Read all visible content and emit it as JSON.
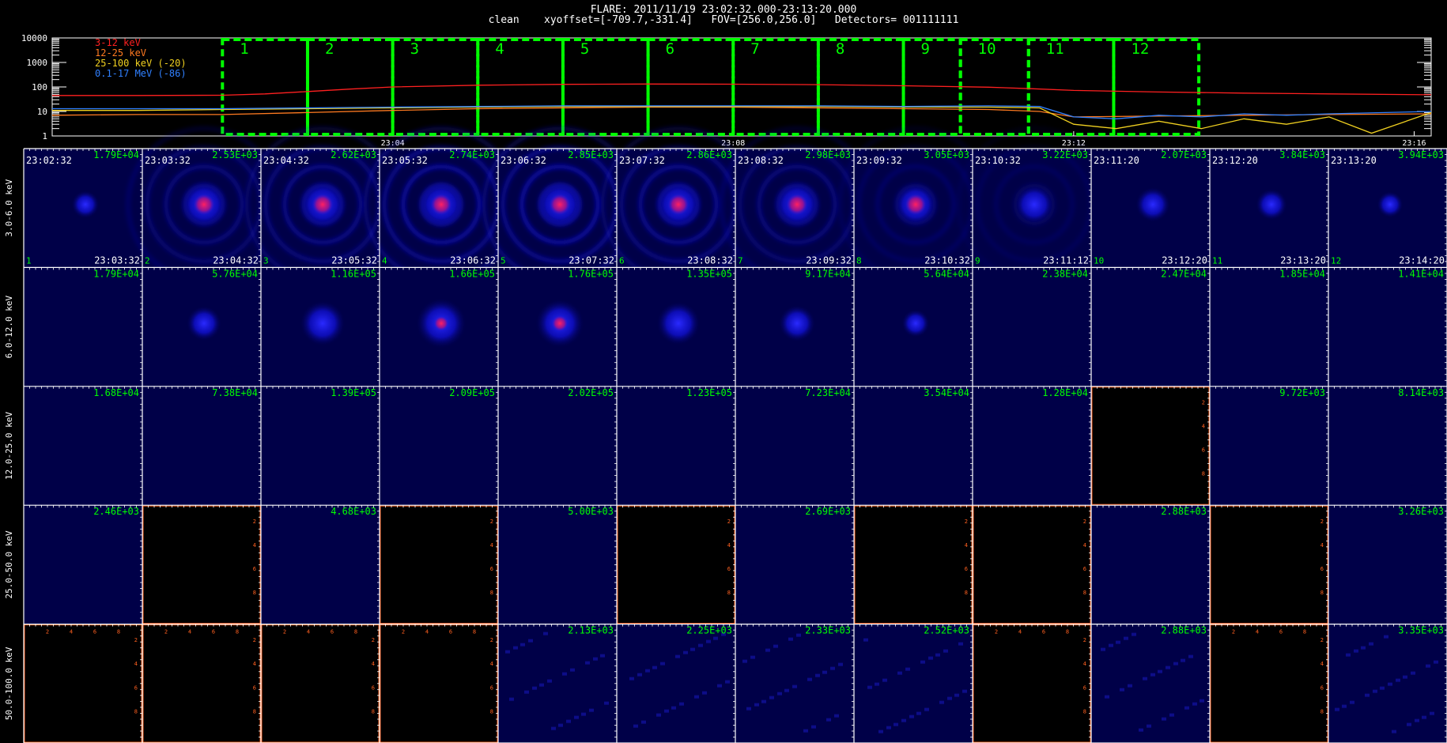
{
  "header": {
    "title": "FLARE: 2011/11/19 23:02:32.000-23:13:20.000",
    "subtitle": "clean    xyoffset=[-709.7,-331.4]   FOV=[256.0,256.0]   Detectors= 001111111"
  },
  "colors": {
    "band_3_12": "#ff2020",
    "band_12_25": "#ff7a20",
    "band_25_100": "#f0d020",
    "band_0_1_17": "#3080ff",
    "interval_box": "#00ff00",
    "grid": "#ffffff",
    "empty_axes": "#ff6020",
    "corner_text": "#00ff00"
  },
  "chart_data": [
    {
      "type": "line",
      "y_scale": "log",
      "ylim": [
        1,
        10000
      ],
      "yticks": [
        "10000",
        "1000",
        "100",
        "10",
        "1"
      ],
      "xticks": [
        "23:04",
        "23:08",
        "23:12",
        "23:16"
      ],
      "xticks_min": [
        2,
        6,
        10,
        14
      ],
      "xlim_min": [
        -2.0,
        14.2
      ],
      "grid": false,
      "legend_placement": "top-left",
      "series": [
        {
          "name": "3-12 keV",
          "color": "#ff2020",
          "points": [
            [
              -2,
              45
            ],
            [
              -1,
              45
            ],
            [
              0,
              46
            ],
            [
              0.5,
              52
            ],
            [
              1,
              65
            ],
            [
              1.5,
              82
            ],
            [
              2,
              100
            ],
            [
              3,
              118
            ],
            [
              4,
              128
            ],
            [
              5,
              132
            ],
            [
              6,
              130
            ],
            [
              7,
              124
            ],
            [
              8,
              112
            ],
            [
              9,
              98
            ],
            [
              9.5,
              85
            ],
            [
              10,
              72
            ],
            [
              11,
              62
            ],
            [
              12,
              56
            ],
            [
              13,
              52
            ],
            [
              14.2,
              48
            ]
          ]
        },
        {
          "name": "12-25 keV",
          "color": "#ff7a20",
          "points": [
            [
              -2,
              7
            ],
            [
              -1,
              7.5
            ],
            [
              0,
              7.5
            ],
            [
              1,
              9
            ],
            [
              2,
              11
            ],
            [
              3,
              13
            ],
            [
              4,
              14
            ],
            [
              5,
              15
            ],
            [
              6,
              15
            ],
            [
              7,
              14
            ],
            [
              8,
              13
            ],
            [
              9,
              12
            ],
            [
              9.6,
              10
            ],
            [
              10,
              6
            ],
            [
              11,
              6.5
            ],
            [
              12,
              7
            ],
            [
              13,
              7.5
            ],
            [
              14.2,
              8
            ]
          ]
        },
        {
          "name": "25-100 keV (-20)",
          "color": "#f0d020",
          "points": [
            [
              -2,
              11
            ],
            [
              -1,
              11
            ],
            [
              0,
              12
            ],
            [
              1,
              13
            ],
            [
              2,
              14
            ],
            [
              3,
              15
            ],
            [
              4,
              16
            ],
            [
              5,
              16
            ],
            [
              6,
              16
            ],
            [
              7,
              16
            ],
            [
              8,
              15
            ],
            [
              9,
              15
            ],
            [
              9.6,
              14
            ],
            [
              10,
              3
            ],
            [
              10.5,
              2
            ],
            [
              11,
              4
            ],
            [
              11.5,
              2
            ],
            [
              12,
              5
            ],
            [
              12.5,
              3
            ],
            [
              13,
              6
            ],
            [
              13.5,
              1.3
            ],
            [
              14.2,
              9
            ]
          ]
        },
        {
          "name": "0.1-17 MeV (-86)",
          "color": "#3080ff",
          "points": [
            [
              -2,
              13
            ],
            [
              -1,
              13
            ],
            [
              0,
              13
            ],
            [
              1,
              14
            ],
            [
              2,
              15
            ],
            [
              3,
              16
            ],
            [
              4,
              17
            ],
            [
              5,
              17
            ],
            [
              6,
              17
            ],
            [
              7,
              17
            ],
            [
              8,
              16
            ],
            [
              9,
              17
            ],
            [
              9.6,
              16
            ],
            [
              10,
              6
            ],
            [
              10.5,
              5
            ],
            [
              11,
              7
            ],
            [
              11.5,
              6
            ],
            [
              12,
              8
            ],
            [
              12.5,
              7
            ],
            [
              13,
              8
            ],
            [
              14.2,
              10
            ]
          ]
        }
      ],
      "intervals": [
        {
          "label": "1",
          "start": 0,
          "end": 1
        },
        {
          "label": "2",
          "start": 1,
          "end": 2
        },
        {
          "label": "3",
          "start": 2,
          "end": 3
        },
        {
          "label": "4",
          "start": 3,
          "end": 4
        },
        {
          "label": "5",
          "start": 4,
          "end": 5
        },
        {
          "label": "6",
          "start": 5,
          "end": 6
        },
        {
          "label": "7",
          "start": 6,
          "end": 7
        },
        {
          "label": "8",
          "start": 7,
          "end": 8
        },
        {
          "label": "9",
          "start": 8,
          "end": 8.67
        },
        {
          "label": "10",
          "start": 8.67,
          "end": 9.47
        },
        {
          "label": "11",
          "start": 9.47,
          "end": 10.47
        },
        {
          "label": "12",
          "start": 10.47,
          "end": 11.47
        }
      ]
    },
    {
      "type": "heatmap",
      "columns": [
        {
          "index": "1",
          "start": "23:02:32",
          "end": "23:03:32"
        },
        {
          "index": "2",
          "start": "23:03:32",
          "end": "23:04:32"
        },
        {
          "index": "3",
          "start": "23:04:32",
          "end": "23:05:32"
        },
        {
          "index": "4",
          "start": "23:05:32",
          "end": "23:06:32"
        },
        {
          "index": "5",
          "start": "23:06:32",
          "end": "23:07:32"
        },
        {
          "index": "6",
          "start": "23:07:32",
          "end": "23:08:32"
        },
        {
          "index": "7",
          "start": "23:08:32",
          "end": "23:09:32"
        },
        {
          "index": "8",
          "start": "23:09:32",
          "end": "23:10:32"
        },
        {
          "index": "9",
          "start": "23:10:32",
          "end": "23:11:12"
        },
        {
          "index": "10",
          "start": "23:11:20",
          "end": "23:12:20"
        },
        {
          "index": "11",
          "start": "23:12:20",
          "end": "23:13:20"
        },
        {
          "index": "12",
          "start": "23:13:20",
          "end": "23:14:20"
        }
      ],
      "rows": [
        {
          "band": "3.0-6.0 keV",
          "max": [
            "1.79E+04",
            "2.53E+03",
            "2.62E+03",
            "2.74E+03",
            "2.85E+03",
            "2.86E+03",
            "2.98E+03",
            "3.05E+03",
            "3.22E+03",
            "2.07E+03",
            "3.84E+03",
            "3.94E+03"
          ],
          "source": [
            0.35,
            1,
            1,
            1,
            1,
            1,
            1,
            0.9,
            0.75,
            0.55,
            0.45,
            0.3
          ],
          "core": [
            0,
            1,
            1,
            1,
            1,
            1,
            1,
            1,
            0,
            0,
            0,
            0
          ],
          "rings": [
            0,
            0.6,
            0.75,
            0.95,
            1,
            0.8,
            0.6,
            0.35,
            0.25,
            0,
            0,
            0
          ]
        },
        {
          "band": "6.0-12.0 keV",
          "max": [
            "1.79E+04",
            "5.76E+04",
            "1.16E+05",
            "1.66E+05",
            "1.76E+05",
            "1.35E+05",
            "9.17E+04",
            "5.64E+04",
            "2.38E+04",
            "2.47E+04",
            "1.85E+04",
            "1.41E+04"
          ],
          "source": [
            0,
            0.55,
            0.85,
            1,
            0.95,
            0.8,
            0.6,
            0.35,
            0,
            0,
            0,
            0
          ],
          "core": [
            0,
            0,
            0,
            0.5,
            0.6,
            0,
            0,
            0,
            0,
            0,
            0,
            0
          ],
          "rings": [
            0,
            0,
            0,
            0,
            0,
            0,
            0,
            0,
            0,
            0,
            0,
            0
          ]
        },
        {
          "band": "12.0-25.0 keV",
          "max": [
            "1.68E+04",
            "7.38E+04",
            "1.39E+05",
            "2.09E+05",
            "2.02E+05",
            "1.23E+05",
            "7.23E+04",
            "3.54E+04",
            "1.28E+04",
            "",
            "9.72E+03",
            "8.14E+03"
          ],
          "source": [
            0,
            0,
            0,
            0,
            0,
            0,
            0,
            0,
            0,
            0,
            0,
            0
          ],
          "core": [
            0,
            0,
            0,
            0,
            0,
            0,
            0,
            0,
            0,
            0,
            0,
            0
          ],
          "rings": [
            0,
            0,
            0,
            0,
            0,
            0,
            0,
            0,
            0,
            0,
            0,
            0
          ]
        },
        {
          "band": "25.0-50.0 keV",
          "max": [
            "2.46E+03",
            "",
            "4.68E+03",
            "",
            "5.00E+03",
            "",
            "2.69E+03",
            "",
            "",
            "2.88E+03",
            "",
            "3.26E+03"
          ],
          "source": [
            0,
            0,
            0,
            0,
            0,
            0,
            0,
            0,
            0,
            0,
            0,
            0
          ],
          "core": [
            0,
            0,
            0,
            0,
            0,
            0,
            0,
            0,
            0,
            0,
            0,
            0
          ],
          "rings": [
            0,
            0,
            0,
            0,
            0,
            0,
            0,
            0,
            0,
            0,
            0,
            0
          ]
        },
        {
          "band": "50.0-100.0 keV",
          "max": [
            "",
            "",
            "",
            "",
            "2.13E+03",
            "2.25E+03",
            "2.33E+03",
            "2.52E+03",
            "",
            "2.88E+03",
            "",
            "3.35E+03"
          ],
          "source": [
            0,
            0,
            0,
            0,
            0,
            0,
            0,
            0,
            0,
            0,
            0,
            0
          ],
          "core": [
            0,
            0,
            0,
            0,
            0,
            0,
            0,
            0,
            0,
            0,
            0,
            0
          ],
          "rings": [
            0,
            0,
            0,
            0,
            0,
            0,
            0,
            0,
            0,
            0,
            0,
            0
          ],
          "noise": [
            0,
            0,
            0,
            0,
            1,
            1,
            1,
            1,
            0,
            1,
            0,
            1
          ]
        }
      ],
      "empty_axis_ticks": [
        "2",
        "4",
        "6",
        "8"
      ]
    }
  ]
}
